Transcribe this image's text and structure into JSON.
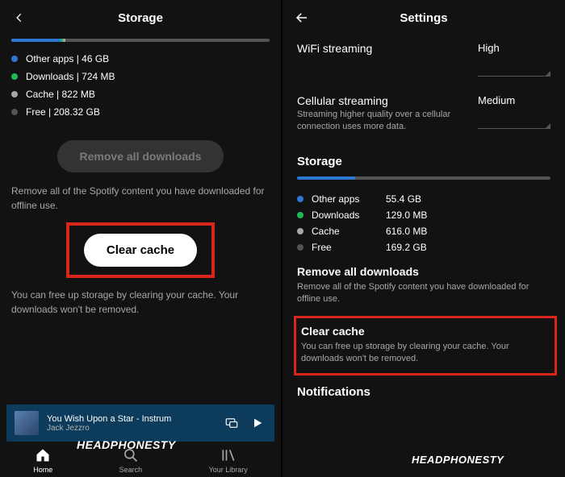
{
  "left": {
    "title": "Storage",
    "legend": [
      {
        "label": "Other apps | 46 GB"
      },
      {
        "label": "Downloads | 724 MB"
      },
      {
        "label": "Cache | 822 MB"
      },
      {
        "label": "Free | 208.32 GB"
      }
    ],
    "remove_downloads_btn": "Remove all downloads",
    "remove_downloads_desc": "Remove all of the Spotify content you have downloaded for offline use.",
    "clear_cache_btn": "Clear cache",
    "clear_cache_desc": "You can free up storage by clearing your cache. Your downloads won't be removed.",
    "now_playing": {
      "title": "You Wish Upon a Star - Instrum",
      "artist": "Jack Jezzro"
    },
    "nav": {
      "home": "Home",
      "search": "Search",
      "library": "Your Library"
    }
  },
  "right": {
    "title": "Settings",
    "wifi": {
      "label": "WiFi streaming",
      "value": "High"
    },
    "cellular": {
      "label": "Cellular streaming",
      "sub": "Streaming higher quality over a cellular connection uses more data.",
      "value": "Medium"
    },
    "storage_title": "Storage",
    "storage": {
      "other": {
        "label": "Other apps",
        "value": "55.4 GB"
      },
      "downloads": {
        "label": "Downloads",
        "value": "129.0 MB"
      },
      "cache": {
        "label": "Cache",
        "value": "616.0 MB"
      },
      "free": {
        "label": "Free",
        "value": "169.2 GB"
      }
    },
    "remove_downloads": {
      "label": "Remove all downloads",
      "sub": "Remove all of the Spotify content you have downloaded for offline use."
    },
    "clear_cache": {
      "label": "Clear cache",
      "sub": "You can free up storage by clearing your cache. Your downloads won't be removed."
    },
    "notifications": "Notifications"
  },
  "watermark": "HEADPHONESTY"
}
